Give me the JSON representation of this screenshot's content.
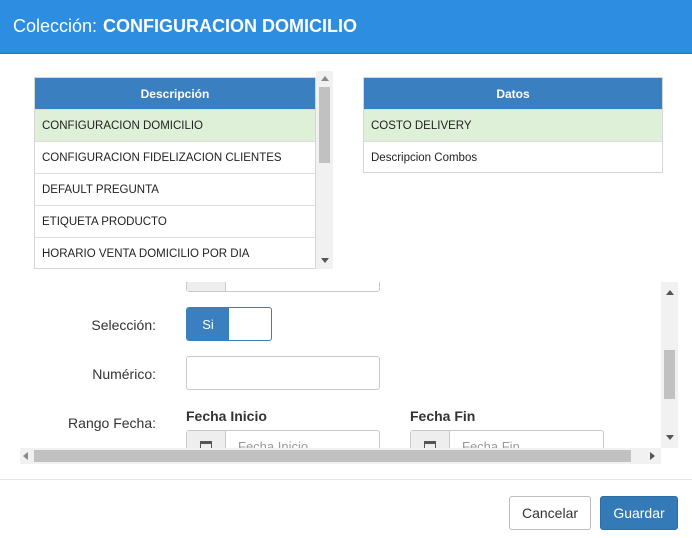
{
  "header": {
    "prefix": "Colección:",
    "name": "CONFIGURACION DOMICILIO"
  },
  "table_descripcion": {
    "header": "Descripción",
    "rows": [
      "CONFIGURACION DOMICILIO",
      "CONFIGURACION FIDELIZACION CLIENTES",
      "DEFAULT PREGUNTA",
      "ETIQUETA PRODUCTO",
      "HORARIO VENTA DOMICILIO POR DIA"
    ],
    "selected_index": 0
  },
  "table_datos": {
    "header": "Datos",
    "rows": [
      "COSTO DELIVERY",
      "Descripcion Combos"
    ],
    "selected_index": 0
  },
  "form": {
    "seleccion_label": "Selección:",
    "toggle_on_label": "Si",
    "numerico_label": "Numérico:",
    "rango_fecha_label": "Rango Fecha:",
    "fecha_inicio_label": "Fecha Inicio",
    "fecha_inicio_placeholder": "Fecha Inicio",
    "fecha_fin_label": "Fecha Fin",
    "fecha_fin_placeholder": "Fecha Fin"
  },
  "footer": {
    "cancel_label": "Cancelar",
    "save_label": "Guardar"
  },
  "colors": {
    "header_bg": "#2d8de0",
    "table_header": "#3a7fc0",
    "selected_row": "#dff0d8",
    "primary": "#337ab7"
  }
}
